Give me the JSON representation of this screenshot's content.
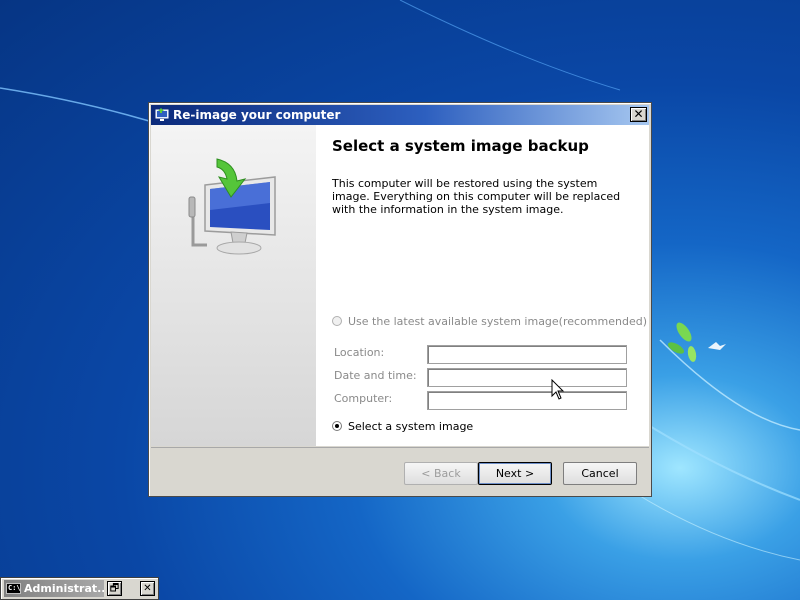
{
  "dialog": {
    "title": "Re-image your computer",
    "close_symbol": "✕",
    "heading": "Select a system image backup",
    "description": "This computer will be restored using the system image. Everything on this computer will be replaced with the information in the system image.",
    "options": {
      "latest_label": "Use the latest available system image(recommended)",
      "select_label": "Select a system image",
      "selected": "select"
    },
    "fields": {
      "location_label": "Location:",
      "location_value": "",
      "datetime_label": "Date and time:",
      "datetime_value": "",
      "computer_label": "Computer:",
      "computer_value": ""
    },
    "buttons": {
      "back": "< Back",
      "next": "Next >",
      "cancel": "Cancel"
    }
  },
  "taskbar": {
    "window_title": "Administrat...",
    "restore_symbol": "🗗",
    "close_symbol": "✕",
    "icon_text": "C:\\"
  },
  "icons": [
    "restore-computer-icon",
    "close-icon",
    "monitor-restore-illustration",
    "cmd-icon",
    "mouse-pointer-icon"
  ],
  "colors": {
    "title_bar_start": "#0b2a7a",
    "title_bar_end": "#a6c7f0",
    "desktop_blue": "#0a47a6",
    "dialog_face": "#d9d7d0"
  }
}
